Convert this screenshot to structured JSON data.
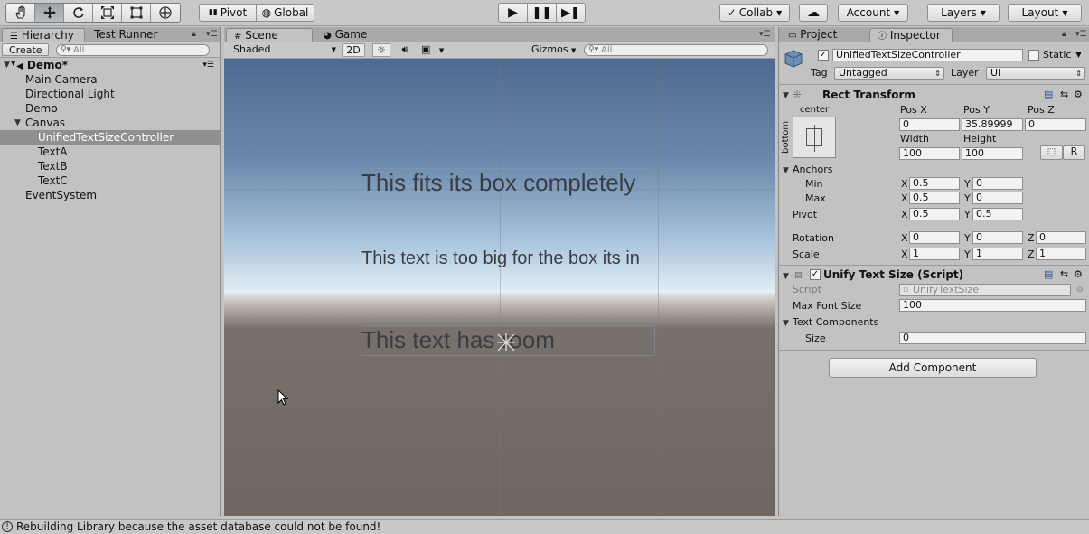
{
  "toolbar": {
    "pivot_label": "Pivot",
    "global_label": "Global",
    "collab_label": "Collab",
    "account_label": "Account",
    "layers_label": "Layers",
    "layout_label": "Layout"
  },
  "hierarchy": {
    "tab_label": "Hierarchy",
    "tab2_label": "Test Runner",
    "create_label": "Create",
    "search_placeholder": "All",
    "scene_name": "Demo*",
    "items": [
      {
        "label": "Main Camera"
      },
      {
        "label": "Directional Light"
      },
      {
        "label": "Demo"
      },
      {
        "label": "Canvas"
      },
      {
        "label": "UnifiedTextSizeController"
      },
      {
        "label": "TextA"
      },
      {
        "label": "TextB"
      },
      {
        "label": "TextC"
      },
      {
        "label": "EventSystem"
      }
    ]
  },
  "scene": {
    "tab_label": "Scene",
    "tab2_label": "Game",
    "shading_mode": "Shaded",
    "mode_2d": "2D",
    "gizmos_label": "Gizmos",
    "search_placeholder": "All",
    "texts": [
      "This fits its box completely",
      "This text is too big for the box its in",
      "This text has room"
    ]
  },
  "inspector": {
    "tab1_label": "Project",
    "tab2_label": "Inspector",
    "object_name": "UnifiedTextSizeController",
    "static_label": "Static",
    "tag_label": "Tag",
    "tag_value": "Untagged",
    "layer_label": "Layer",
    "layer_value": "UI",
    "rect_transform_title": "Rect Transform",
    "anchor_preset_h": "center",
    "anchor_preset_v": "bottom",
    "pos_x_label": "Pos X",
    "pos_y_label": "Pos Y",
    "pos_z_label": "Pos Z",
    "pos_x": "0",
    "pos_y": "35.89999",
    "pos_z": "0",
    "width_label": "Width",
    "height_label": "Height",
    "width": "100",
    "height": "100",
    "r_label": "R",
    "anchors_label": "Anchors",
    "min_label": "Min",
    "max_label": "Max",
    "pivot_label": "Pivot",
    "rotation_label": "Rotation",
    "scale_label": "Scale",
    "x_label": "X",
    "y_label": "Y",
    "z_label": "Z",
    "anchor_min_x": "0.5",
    "anchor_min_y": "0",
    "anchor_max_x": "0.5",
    "anchor_max_y": "0",
    "pivot_x": "0.5",
    "pivot_y": "0.5",
    "rotation_x": "0",
    "rotation_y": "0",
    "rotation_z": "0",
    "scale_x": "1",
    "scale_y": "1",
    "scale_z": "1",
    "script_component_title": "Unify Text Size (Script)",
    "script_label": "Script",
    "script_value": "UnifyTextSize",
    "max_font_size_label": "Max Font Size",
    "max_font_size": "100",
    "text_components_label": "Text Components",
    "size_label": "Size",
    "size_value": "0",
    "add_component_label": "Add Component"
  },
  "status": {
    "message": "Rebuilding Library because the asset database could not be found!"
  }
}
